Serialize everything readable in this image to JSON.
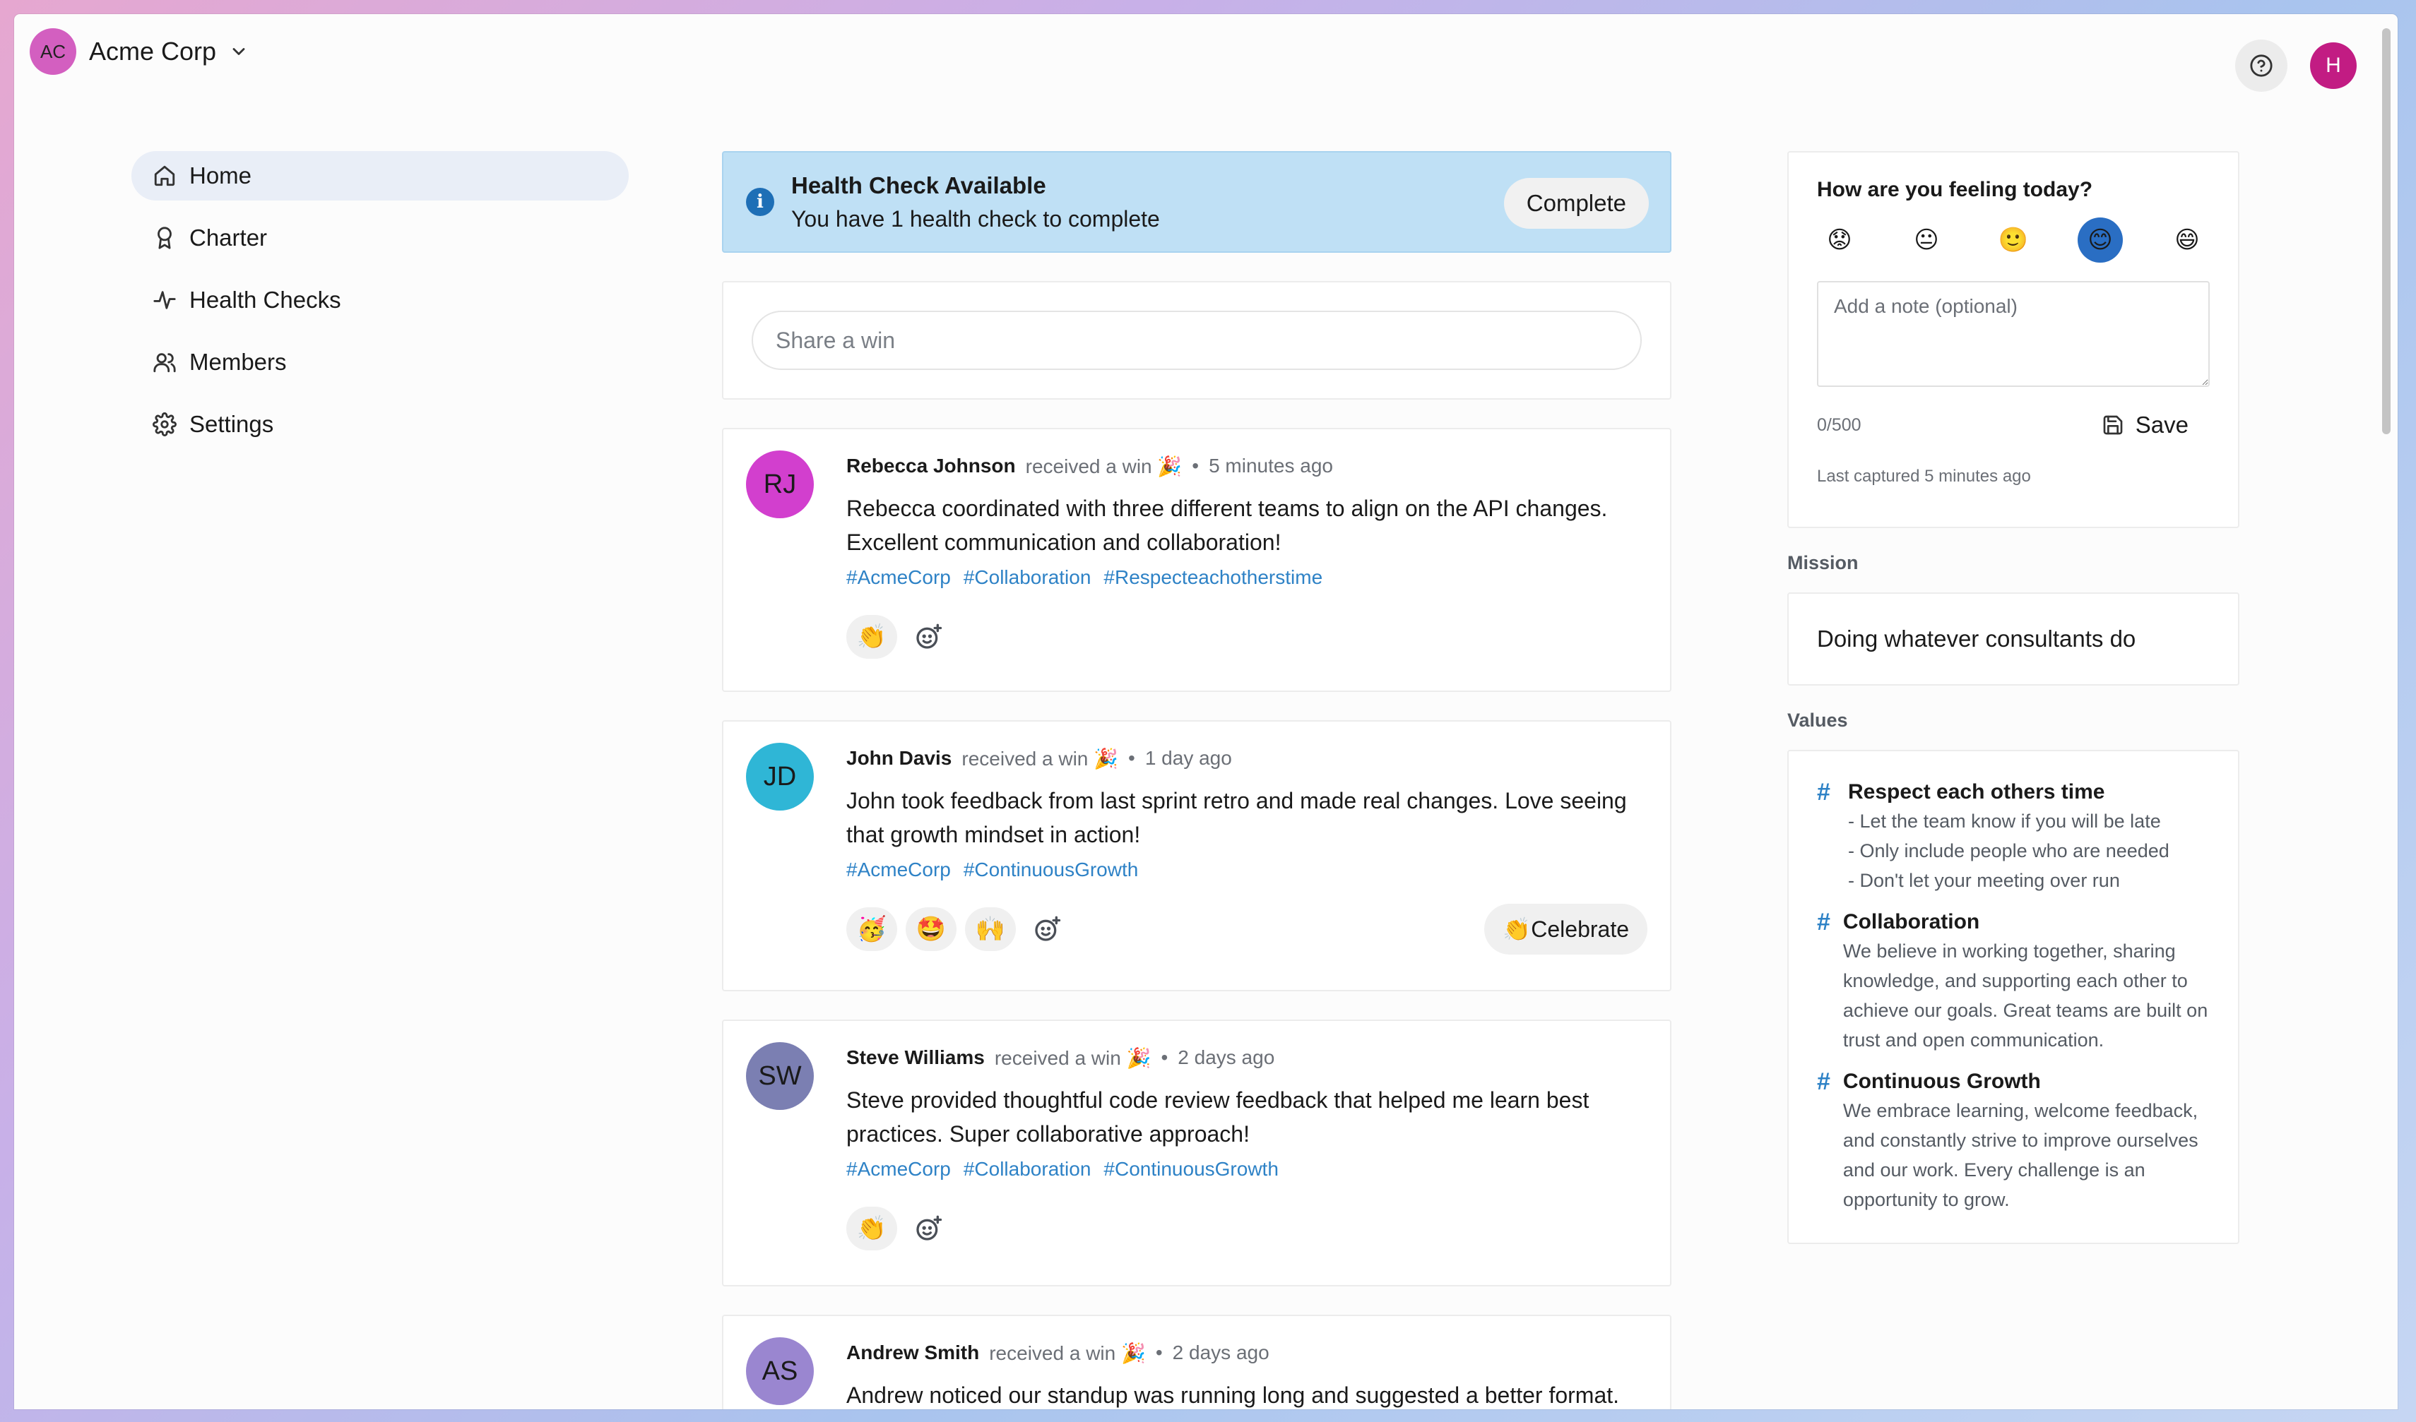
{
  "org": {
    "initials": "AC",
    "name": "Acme Corp"
  },
  "user": {
    "initial": "H"
  },
  "nav": [
    {
      "label": "Home",
      "icon": "home-icon",
      "active": true
    },
    {
      "label": "Charter",
      "icon": "award-icon",
      "active": false
    },
    {
      "label": "Health Checks",
      "icon": "activity-icon",
      "active": false
    },
    {
      "label": "Members",
      "icon": "users-icon",
      "active": false
    },
    {
      "label": "Settings",
      "icon": "gear-icon",
      "active": false
    }
  ],
  "banner": {
    "title": "Health Check Available",
    "subtitle": "You have 1 health check to complete",
    "button": "Complete"
  },
  "share": {
    "placeholder": "Share a win"
  },
  "posts": [
    {
      "initials": "RJ",
      "avatar_color": "#d23fce",
      "name": "Rebecca Johnson",
      "action": "received a win 🎉",
      "time": "5 minutes ago",
      "body": "Rebecca coordinated with three different teams to align on the API changes. Excellent communication and collaboration!",
      "tags": [
        "#AcmeCorp",
        "#Collaboration",
        "#Respecteachotherstime"
      ],
      "reactions": [
        "👏"
      ]
    },
    {
      "initials": "JD",
      "avatar_color": "#2fb6d6",
      "name": "John Davis",
      "action": "received a win 🎉",
      "time": "1 day ago",
      "body": "John took feedback from last sprint retro and made real changes. Love seeing that growth mindset in action!",
      "tags": [
        "#AcmeCorp",
        "#ContinuousGrowth"
      ],
      "reactions": [
        "🥳",
        "🤩",
        "🙌"
      ],
      "celebrate": "👏Celebrate"
    },
    {
      "initials": "SW",
      "avatar_color": "#7b7fb2",
      "name": "Steve Williams",
      "action": "received a win 🎉",
      "time": "2 days ago",
      "body": "Steve provided thoughtful code review feedback that helped me learn best practices. Super collaborative approach!",
      "tags": [
        "#AcmeCorp",
        "#Collaboration",
        "#ContinuousGrowth"
      ],
      "reactions": [
        "👏"
      ]
    },
    {
      "initials": "AS",
      "avatar_color": "#9a86d0",
      "name": "Andrew Smith",
      "action": "received a win 🎉",
      "time": "2 days ago",
      "body": "Andrew noticed our standup was running long and suggested a better format.",
      "tags": [],
      "reactions": []
    }
  ],
  "mood": {
    "question": "How are you feeling today?",
    "options": [
      "😟",
      "😐",
      "🙂",
      "😊",
      "😄"
    ],
    "selected_index": 3,
    "note_placeholder": "Add a note (optional)",
    "counter": "0/500",
    "save": "Save",
    "last_captured": "Last captured 5 minutes ago"
  },
  "mission": {
    "label": "Mission",
    "text": "Doing whatever consultants do"
  },
  "values": {
    "label": "Values",
    "items": [
      {
        "title": "Respect each others time",
        "desc": "- Let the team know if you will be late\n- Only include people who are needed\n- Don't let your meeting over run"
      },
      {
        "title": "Collaboration",
        "desc": "We believe in working together, sharing knowledge, and supporting each other to achieve our goals. Great teams are built on trust and open communication."
      },
      {
        "title": "Continuous Growth",
        "desc": "We embrace learning, welcome feedback, and constantly strive to improve ourselves and our work. Every challenge is an opportunity to grow."
      }
    ]
  },
  "colors": {
    "accent": "#2e82c6",
    "banner_bg": "#bfe0f5",
    "selected_mood": "#2a6ec3",
    "user_avatar": "#c21c83",
    "org_avatar": "#d35fc0"
  }
}
